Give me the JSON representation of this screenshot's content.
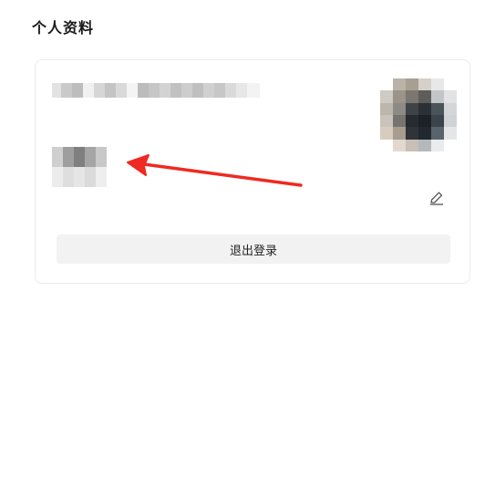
{
  "header": {
    "title": "个人资料"
  },
  "profile_card": {
    "logout_label": "退出登录",
    "edit_icon": "pencil-icon",
    "avatar_icon": "avatar-redacted"
  },
  "colors": {
    "annotation_arrow": "#ee2a22",
    "card_border": "#ececec",
    "button_bg": "#f2f2f2"
  }
}
